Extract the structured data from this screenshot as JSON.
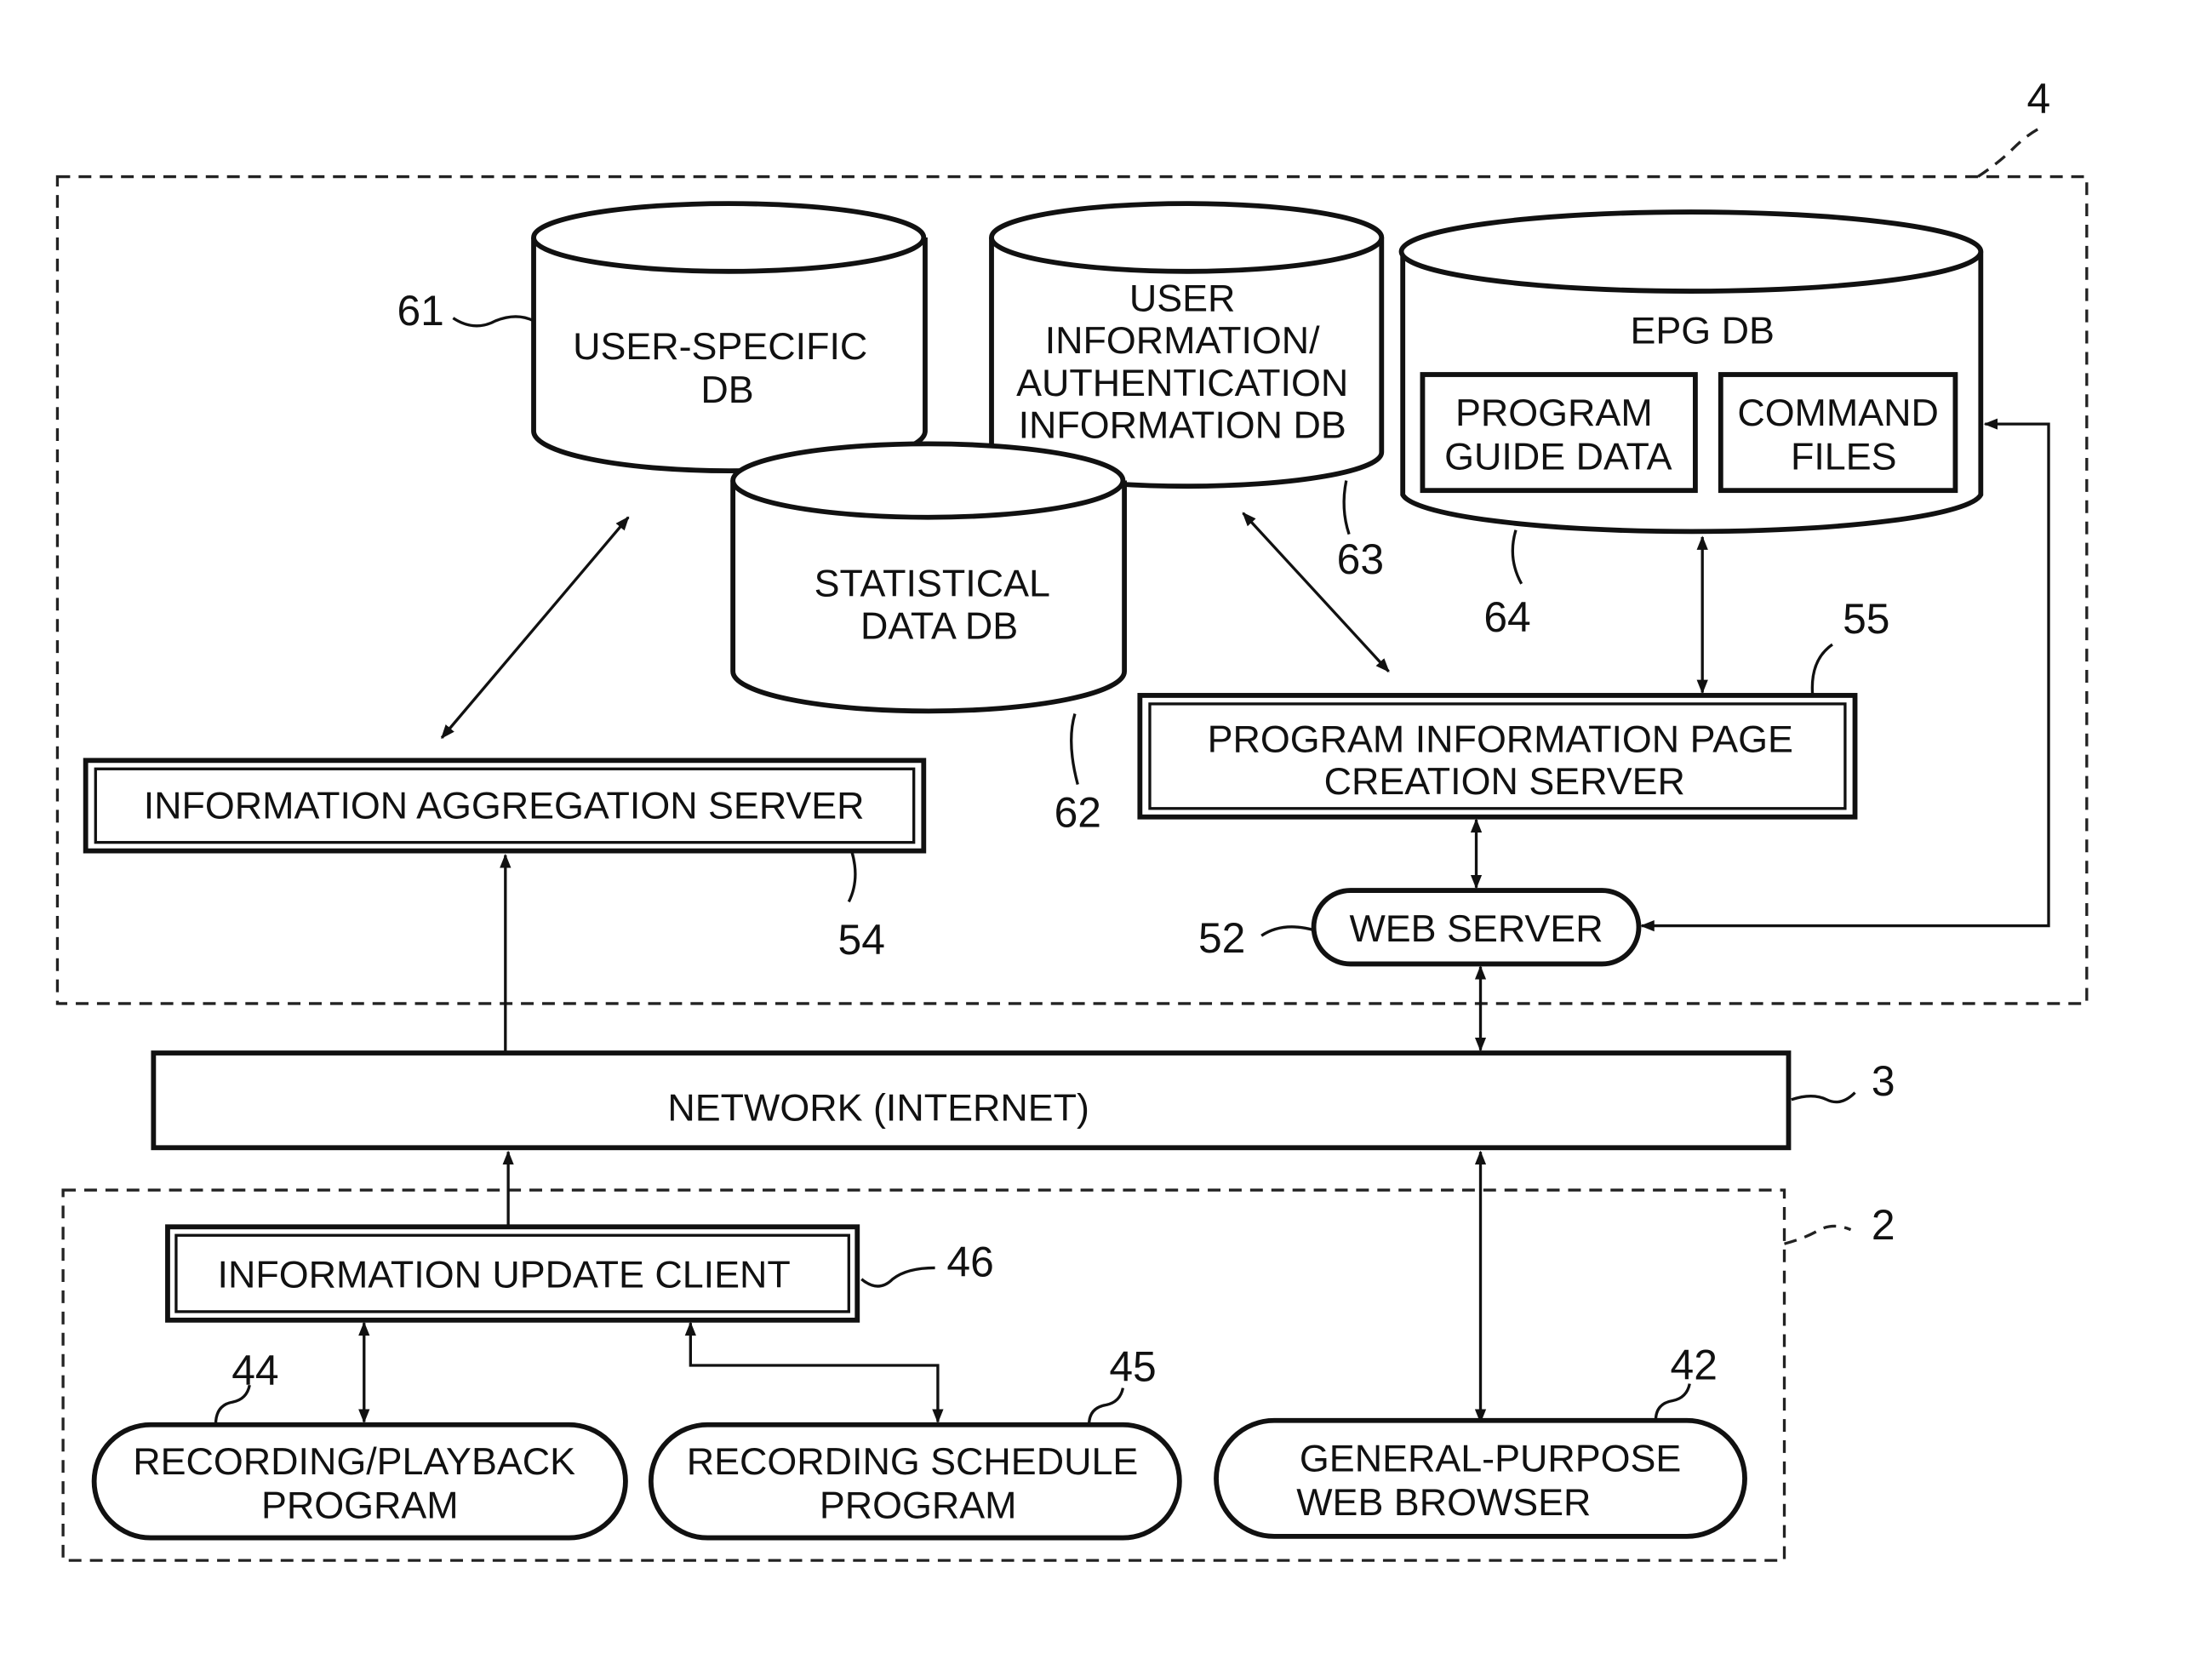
{
  "diagram": {
    "system_boundary": {
      "ref": "4"
    },
    "client_boundary": {
      "ref": "2"
    },
    "databases": [
      {
        "id": "db61",
        "ref": "61",
        "lines": [
          "USER-SPECIFIC",
          "DB"
        ]
      },
      {
        "id": "db62",
        "ref": "62",
        "lines": [
          "STATISTICAL",
          "DATA DB"
        ]
      },
      {
        "id": "db63",
        "ref": "63",
        "lines": [
          "USER",
          "INFORMATION/",
          "AUTHENTICATION",
          "INFORMATION DB"
        ]
      },
      {
        "id": "db64",
        "ref": "64",
        "title": "EPG DB",
        "sub": [
          [
            "PROGRAM",
            "GUIDE DATA"
          ],
          [
            "COMMAND",
            "FILES"
          ]
        ]
      }
    ],
    "servers": {
      "aggregation": {
        "ref": "54",
        "label": "INFORMATION AGGREGATION SERVER"
      },
      "page_creation": {
        "ref": "55",
        "lines": [
          "PROGRAM INFORMATION PAGE",
          "CREATION SERVER"
        ]
      },
      "web_server": {
        "ref": "52",
        "label": "WEB SERVER"
      }
    },
    "network": {
      "ref": "3",
      "label": "NETWORK (INTERNET)"
    },
    "client": {
      "update_client": {
        "ref": "46",
        "label": "INFORMATION UPDATE CLIENT"
      },
      "programs": [
        {
          "ref": "44",
          "lines": [
            "RECORDING/PLAYBACK",
            "PROGRAM"
          ]
        },
        {
          "ref": "45",
          "lines": [
            "RECORDING SCHEDULE",
            "PROGRAM"
          ]
        },
        {
          "ref": "42",
          "lines": [
            "GENERAL-PURPOSE",
            "WEB BROWSER"
          ]
        }
      ]
    }
  }
}
